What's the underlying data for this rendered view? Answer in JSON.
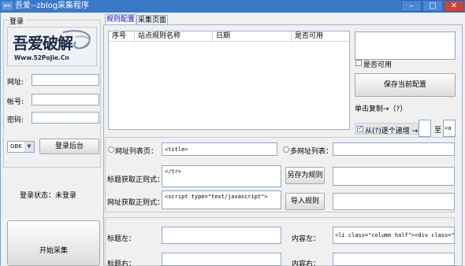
{
  "window": {
    "app_icon_text": "em",
    "title": "吾爱--zblog采集程序",
    "minimize": "–",
    "maximize": "□",
    "close": "✕"
  },
  "login": {
    "group_title": "登录",
    "logo_text_cn": "吾爱破解",
    "logo_text_url": "Www.52PoJie.Cn",
    "url_label": "网址:",
    "account_label": "帐号:",
    "password_label": "密码:",
    "url_value": "",
    "account_value": "",
    "password_value": "",
    "encoding_value": "GBK",
    "login_button": "登录后台",
    "status_label": "登录状态：未登录",
    "start_button": "开始采集"
  },
  "tabs": [
    "规则配置",
    "采集页面"
  ],
  "rules_table": {
    "columns": [
      "序号",
      "站点规则名称",
      "日期",
      "是否可用"
    ],
    "rows": []
  },
  "side": {
    "rule_name_value": "",
    "available_label": "是否可用",
    "save_button": "保存当前配置",
    "copy_hint": "单击复制→（?）",
    "increment_label": "从(?)逐个递增 →",
    "from_value": "",
    "to_label": "至",
    "to_value": "<a"
  },
  "config": {
    "list_page_label": "网址列表页：",
    "list_page_value": "<title>",
    "multi_list_label": "多网址列表：",
    "multi_list_value": "",
    "title_regex_label": "标题获取正则式：",
    "title_regex_value": "</tr>",
    "url_regex_label": "网址获取正则式：",
    "url_regex_value": "<script type=\"text/javascript\">",
    "save_as_rule": "另存为规则",
    "import_rule": "导入规则",
    "save_as_value": "",
    "import_value": "",
    "title_left_label": "标题左：",
    "title_left_value": "",
    "title_right_label": "标题右：",
    "title_right_value": "",
    "content_left_label": "内容左：",
    "content_left_value": "<li class=\"column half\"><div class=\"lb",
    "content_right_label": "内容右：",
    "content_right_value": ""
  },
  "colors": {
    "titlebar": "#3a78c8",
    "close": "#c9443a",
    "tab_active_text": "#0000cc"
  }
}
